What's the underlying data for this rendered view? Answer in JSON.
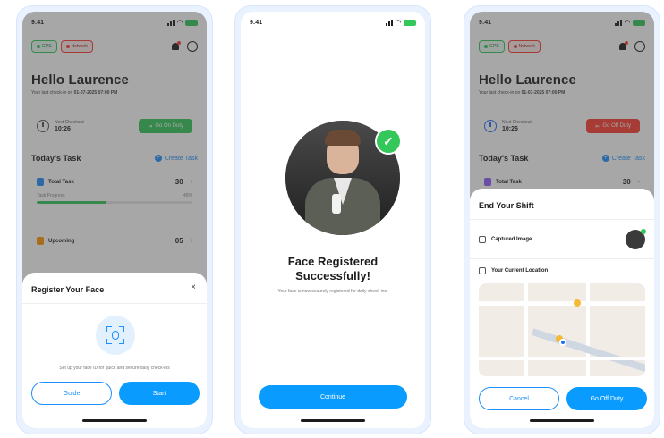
{
  "status": {
    "time": "9:41"
  },
  "dashboard": {
    "chip_gps": "GPS",
    "chip_network": "Network",
    "greeting": "Hello Laurence",
    "subtitle_prefix": "Your last check-in on",
    "subtitle_date": "01-07-2025 07:00 PM",
    "checkin_label": "Next Checkout",
    "checkin_time": "10:26",
    "on_duty_label": "Go On Duty",
    "off_duty_label": "Go Off Duty",
    "tasks_title": "Today's Task",
    "create_task": "Create Task",
    "total_task_label": "Total Task",
    "total_task_value": "30",
    "progress_label": "Task Progress",
    "progress_value": "45%",
    "progress": 0.45,
    "upcoming_label": "Upcoming",
    "upcoming_value": "05"
  },
  "register_sheet": {
    "title": "Register Your Face",
    "description": "Set up your face ID for quick and secure daily check-ins",
    "guide": "Guide",
    "start": "Start"
  },
  "success": {
    "title_line1": "Face Registered",
    "title_line2": "Successfully!",
    "subtitle": "Your face is now securely registered for daily check-ins.",
    "continue": "Continue"
  },
  "end_shift": {
    "title": "End Your Shift",
    "captured_image": "Captured Image",
    "current_location": "Your Current Location",
    "cancel": "Cancel",
    "go_off_duty": "Go Off Duty"
  },
  "colors": {
    "primary": "#0a9bff",
    "success": "#34c759",
    "danger": "#ff3b30"
  }
}
